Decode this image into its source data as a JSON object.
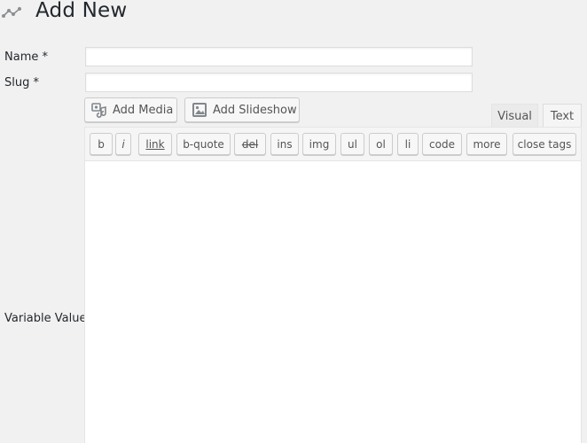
{
  "header": {
    "title": "Add New",
    "icon": "analytics-icon"
  },
  "form": {
    "name_label": "Name *",
    "name_value": "",
    "slug_label": "Slug *",
    "slug_value": "",
    "value_label": "Variable Value"
  },
  "media_buttons": {
    "add_media": "Add Media",
    "add_slideshow": "Add Slideshow"
  },
  "editor": {
    "tabs": {
      "visual": "Visual",
      "text": "Text",
      "active": "Text"
    },
    "quicktags": {
      "b": "b",
      "i": "i",
      "link": "link",
      "b_quote": "b-quote",
      "del": "del",
      "ins": "ins",
      "img": "img",
      "ul": "ul",
      "ol": "ol",
      "li": "li",
      "code": "code",
      "more": "more",
      "close_tags": "close tags"
    },
    "content": ""
  },
  "colors": {
    "background": "#f1f1f1",
    "text": "#23282d",
    "button_text": "#555555",
    "border": "#cccccc"
  }
}
